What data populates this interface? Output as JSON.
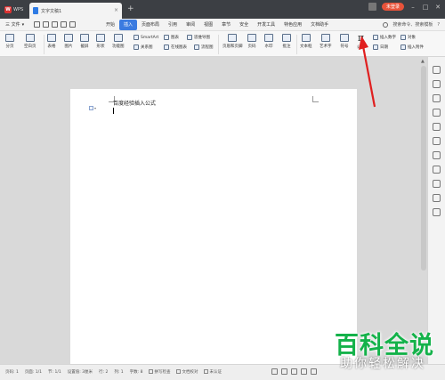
{
  "titlebar": {
    "app_tab": "WPS",
    "doc_tab": "文字文稿1",
    "close_glyph": "×",
    "new_tab_glyph": "+",
    "search_text": "搜索命令、搜索模板",
    "help": "?",
    "login_label": "未登录"
  },
  "menubar": {
    "file_label": "三 文件",
    "file_arrow": "▾",
    "items": [
      "开始",
      "插入",
      "页面布局",
      "引用",
      "审阅",
      "视图",
      "章节",
      "安全",
      "开发工具",
      "特色应用",
      "文档助手"
    ],
    "active_item": "插入"
  },
  "ribbon": {
    "fenye": "分页",
    "kongbaiye": "空白页",
    "biaoge": "表格",
    "tupian": "图片",
    "jietu": "截屏",
    "xingzhuang": "形状",
    "gongneng": "功能图",
    "smartart": "SmartArt",
    "tubiao": "图表",
    "guanxitu": "关系图",
    "siweidaotu": "思维导图",
    "zaixiantubiao": "在线图表",
    "liuchengtu": "流程图",
    "yemei": "页眉和页脚",
    "yema": "页码",
    "shuiyin": "水印",
    "pizhu": "批注",
    "wenbenkuang": "文本框",
    "yishuzi": "艺术字",
    "fuhao": "符号",
    "gongshi_symbol": "π",
    "gongshi": "公式",
    "charushuzi": "插入数字",
    "duixiang": "对象",
    "riqi": "日期",
    "fujian": "插入附件"
  },
  "document": {
    "text": "百度经验插入公式"
  },
  "statusbar": {
    "items": [
      "页码: 1",
      "页面: 1/1",
      "节: 1/1",
      "设置值: 3厘米",
      "行: 2",
      "列: 1",
      "字数: 8",
      "拼写检查",
      "文档校对",
      "未认证"
    ]
  },
  "watermark": {
    "title": "百科全说",
    "subtitle": "助你轻松解决"
  },
  "colors": {
    "accent": "#3b7be0",
    "arrow": "#e02020",
    "watermark": "#14b24a"
  }
}
